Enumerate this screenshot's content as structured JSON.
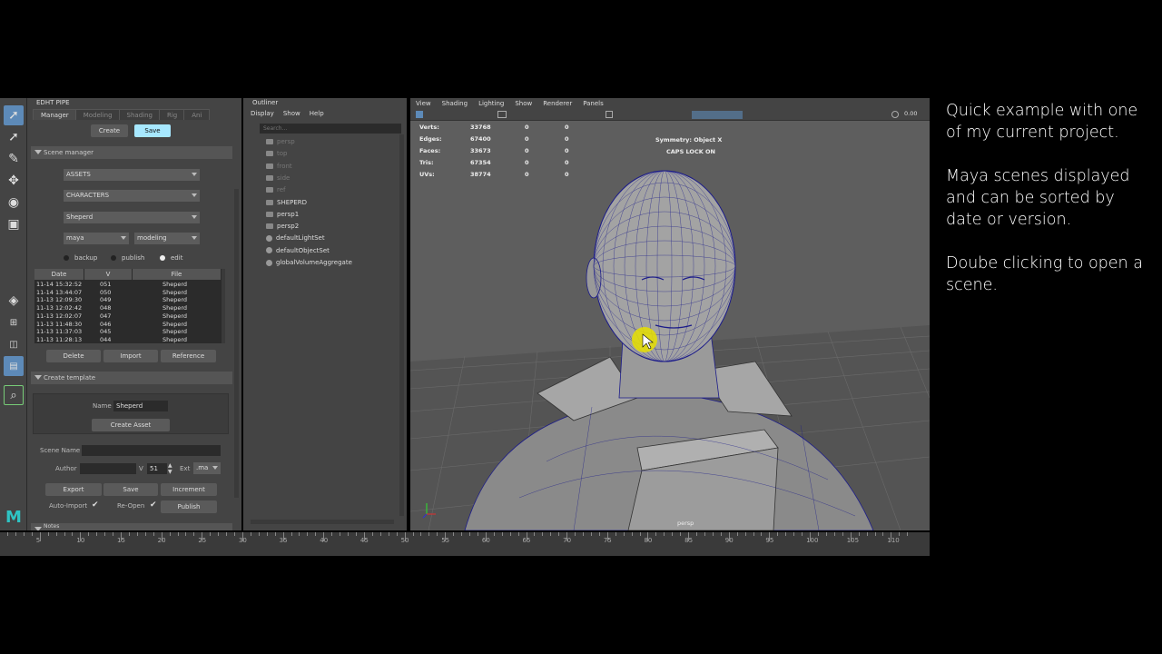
{
  "pipe": {
    "title": "EDHT PIPE",
    "tabs": [
      "Manager",
      "Modeling",
      "Shading",
      "Rig",
      "Ani"
    ],
    "create_label": "Create",
    "save_label": "Save",
    "scene_manager": {
      "section_label": "Scene manager",
      "dropdowns": [
        "ASSETS",
        "CHARACTERS",
        "Sheperd"
      ],
      "software": "maya",
      "stage": "modeling",
      "radios": [
        {
          "label": "backup",
          "selected": false
        },
        {
          "label": "publish",
          "selected": false
        },
        {
          "label": "edit",
          "selected": true
        }
      ],
      "columns": [
        "Date",
        "V",
        "File"
      ],
      "rows": [
        {
          "date": "11-14 15:32:52",
          "v": "051",
          "file": "Sheperd"
        },
        {
          "date": "11-14 13:44:07",
          "v": "050",
          "file": "Sheperd"
        },
        {
          "date": "11-13 12:09:30",
          "v": "049",
          "file": "Sheperd"
        },
        {
          "date": "11-13 12:02:42",
          "v": "048",
          "file": "Sheperd"
        },
        {
          "date": "11-13 12:02:07",
          "v": "047",
          "file": "Sheperd"
        },
        {
          "date": "11-13 11:48:30",
          "v": "046",
          "file": "Sheperd"
        },
        {
          "date": "11-13 11:37:03",
          "v": "045",
          "file": "Sheperd"
        },
        {
          "date": "11-13 11:28:13",
          "v": "044",
          "file": "Sheperd"
        }
      ],
      "delete_label": "Delete",
      "import_label": "Import",
      "reference_label": "Reference"
    },
    "template": {
      "section_label": "Create template",
      "name_label": "Name",
      "name_value": "Sheperd",
      "create_asset_label": "Create Asset"
    },
    "scene_name_label": "Scene Name",
    "scene_name_value": "",
    "author_label": "Author",
    "author_value": "",
    "v_label": "V",
    "v_value": "51",
    "ext_label": "Ext",
    "ext_value": ".ma",
    "export_label": "Export",
    "save2_label": "Save",
    "increment_label": "Increment",
    "auto_import_label": "Auto-Import",
    "auto_import_checked": "✔",
    "reopen_label": "Re-Open",
    "reopen_checked": "✔",
    "publish_label": "Publish",
    "notes_label": "Notes"
  },
  "outliner": {
    "title": "Outliner",
    "menu": [
      "Display",
      "Show",
      "Help"
    ],
    "search_placeholder": "Search...",
    "items": [
      {
        "label": "persp",
        "dim": true,
        "type": "camera"
      },
      {
        "label": "top",
        "dim": true,
        "type": "camera"
      },
      {
        "label": "front",
        "dim": true,
        "type": "camera"
      },
      {
        "label": "side",
        "dim": true,
        "type": "camera"
      },
      {
        "label": "ref",
        "dim": true,
        "type": "group"
      },
      {
        "label": "SHEPERD",
        "dim": false,
        "type": "group"
      },
      {
        "label": "persp1",
        "dim": false,
        "type": "camera"
      },
      {
        "label": "persp2",
        "dim": false,
        "type": "camera"
      },
      {
        "label": "defaultLightSet",
        "dim": false,
        "type": "set"
      },
      {
        "label": "defaultObjectSet",
        "dim": false,
        "type": "set"
      },
      {
        "label": "globalVolumeAggregate",
        "dim": false,
        "type": "set"
      }
    ]
  },
  "viewport": {
    "menu": [
      "View",
      "Shading",
      "Lighting",
      "Show",
      "Renderer",
      "Panels"
    ],
    "stats": [
      {
        "label": "Verts:",
        "count": "33768",
        "a": "0",
        "b": "0"
      },
      {
        "label": "Edges:",
        "count": "67400",
        "a": "0",
        "b": "0"
      },
      {
        "label": "Faces:",
        "count": "33673",
        "a": "0",
        "b": "0"
      },
      {
        "label": "Tris:",
        "count": "67354",
        "a": "0",
        "b": "0"
      },
      {
        "label": "UVs:",
        "count": "38774",
        "a": "0",
        "b": "0"
      }
    ],
    "symmetry": "Symmetry: Object X",
    "caps": "CAPS LOCK ON",
    "camera": "persp",
    "value_readout": "0.00"
  },
  "timeline": {
    "labels": [
      "5",
      "10",
      "15",
      "20",
      "25",
      "30",
      "35",
      "40",
      "45",
      "50",
      "55",
      "60",
      "65",
      "70",
      "75",
      "80",
      "85",
      "90",
      "95",
      "100",
      "105",
      "110"
    ]
  },
  "caption": {
    "p1": "Quick example with one of my current project.",
    "p2": "Maya scenes displayed and can be sorted by date or version.",
    "p3": "Doube clicking to open a scene."
  },
  "colors": {
    "accent": "#a7e8ff",
    "wire": "#1c1c8a",
    "cursor_highlight": "#e8e000"
  }
}
